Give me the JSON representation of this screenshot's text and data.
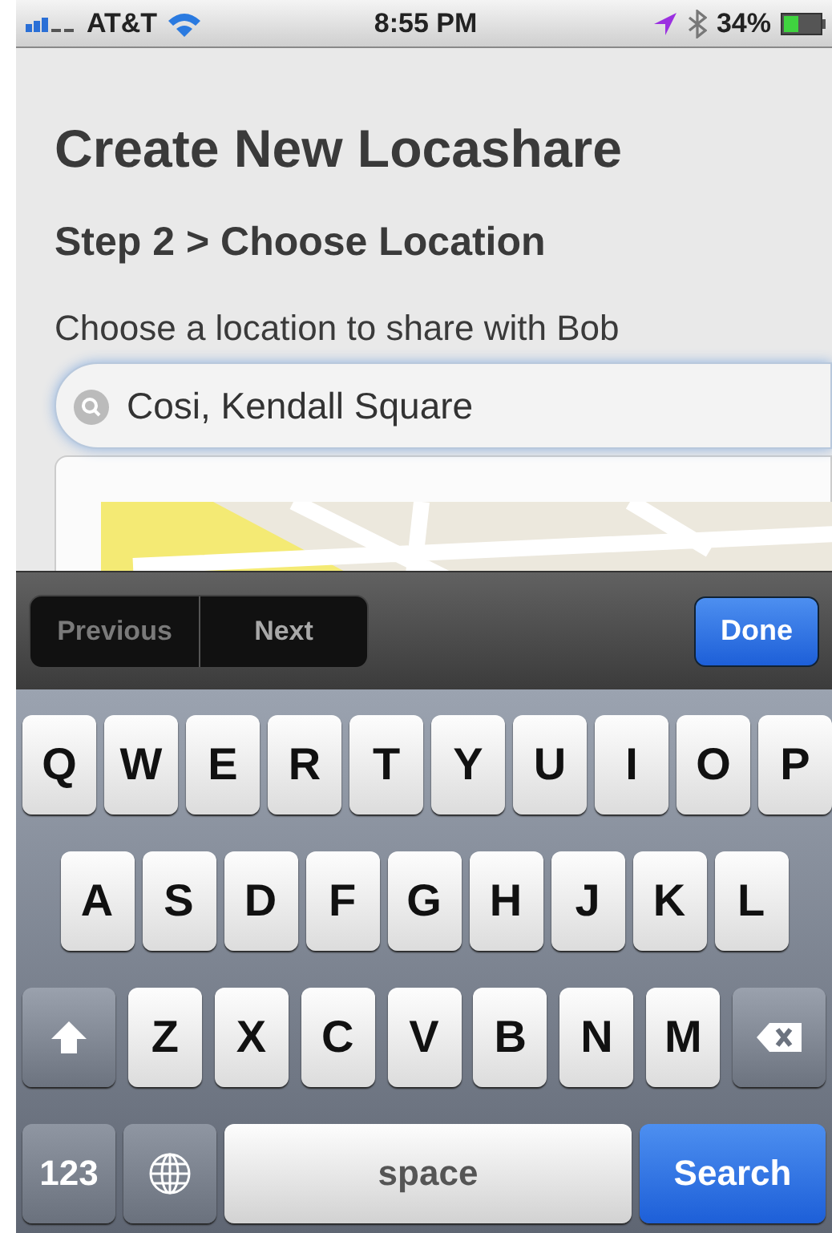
{
  "status_bar": {
    "carrier": "AT&T",
    "time": "8:55 PM",
    "battery": "34%"
  },
  "page": {
    "title": "Create New Locashare",
    "step": "Step 2 > Choose Location",
    "instruction": "Choose a location to share with Bob"
  },
  "search": {
    "value": "Cosi, Kendall Square"
  },
  "accessory": {
    "nav": [
      {
        "label": "Previous",
        "disabled": true
      },
      {
        "label": "Next",
        "disabled": false
      }
    ],
    "done": "Done"
  },
  "keyboard": {
    "rows": [
      {
        "keys": [
          {
            "kind": "letter",
            "label": "Q"
          },
          {
            "kind": "letter",
            "label": "W"
          },
          {
            "kind": "letter",
            "label": "E"
          },
          {
            "kind": "letter",
            "label": "R"
          },
          {
            "kind": "letter",
            "label": "T"
          },
          {
            "kind": "letter",
            "label": "Y"
          },
          {
            "kind": "letter",
            "label": "U"
          },
          {
            "kind": "letter",
            "label": "I"
          },
          {
            "kind": "letter",
            "label": "O"
          },
          {
            "kind": "letter",
            "label": "P"
          }
        ]
      },
      {
        "keys": [
          {
            "kind": "letter",
            "label": "A"
          },
          {
            "kind": "letter",
            "label": "S"
          },
          {
            "kind": "letter",
            "label": "D"
          },
          {
            "kind": "letter",
            "label": "F"
          },
          {
            "kind": "letter",
            "label": "G"
          },
          {
            "kind": "letter",
            "label": "H"
          },
          {
            "kind": "letter",
            "label": "J"
          },
          {
            "kind": "letter",
            "label": "K"
          },
          {
            "kind": "letter",
            "label": "L"
          }
        ]
      },
      {
        "keys": [
          {
            "kind": "shift"
          },
          {
            "kind": "letter",
            "label": "Z"
          },
          {
            "kind": "letter",
            "label": "X"
          },
          {
            "kind": "letter",
            "label": "C"
          },
          {
            "kind": "letter",
            "label": "V"
          },
          {
            "kind": "letter",
            "label": "B"
          },
          {
            "kind": "letter",
            "label": "N"
          },
          {
            "kind": "letter",
            "label": "M"
          },
          {
            "kind": "delete"
          }
        ]
      },
      {
        "keys": [
          {
            "kind": "mode",
            "label": "123"
          },
          {
            "kind": "globe"
          },
          {
            "kind": "space",
            "label": "space"
          },
          {
            "kind": "action",
            "label": "Search"
          }
        ]
      }
    ]
  }
}
